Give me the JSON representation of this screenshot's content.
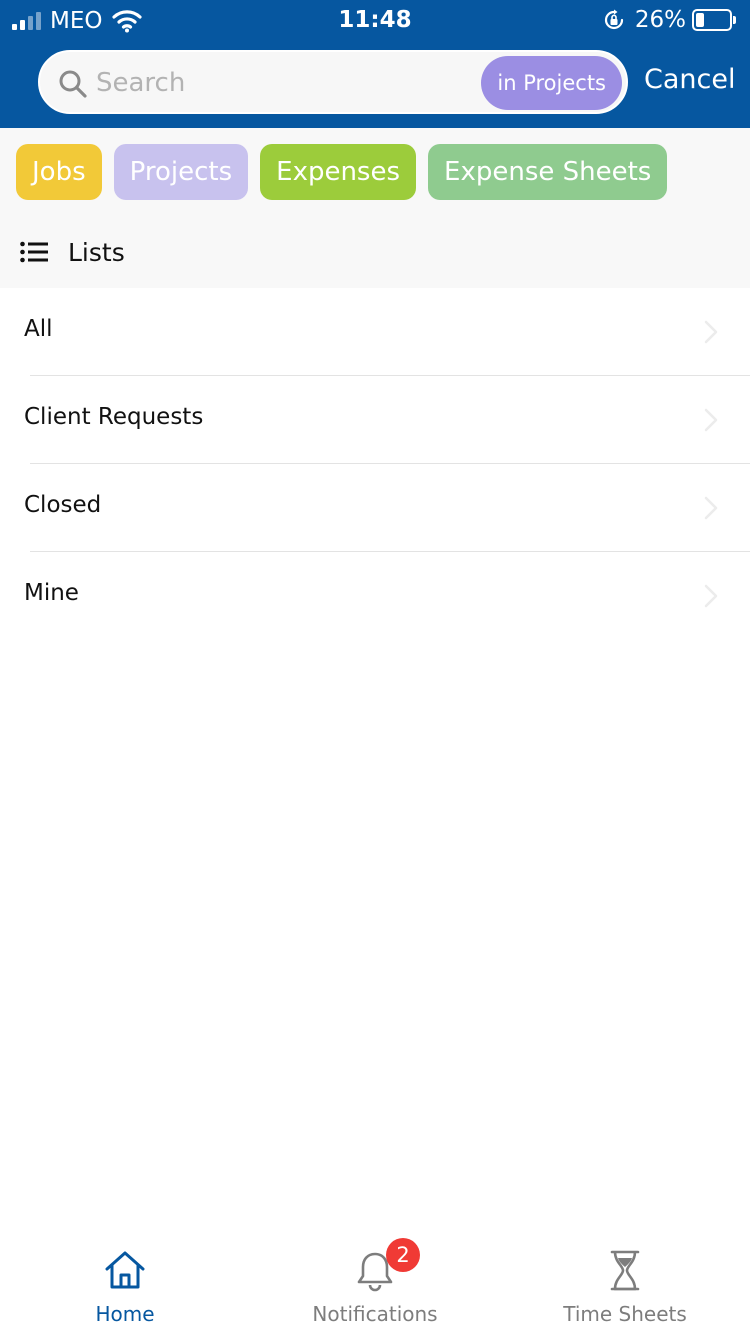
{
  "status_bar": {
    "carrier": "MEO",
    "time": "11:48",
    "battery_percent": "26%",
    "battery_level": 0.26
  },
  "search": {
    "placeholder": "Search",
    "value": "",
    "scope_label": "in Projects",
    "cancel_label": "Cancel"
  },
  "filters": [
    {
      "label": "Jobs",
      "color": "#f2c938"
    },
    {
      "label": "Projects",
      "color": "#c8c2ee"
    },
    {
      "label": "Expenses",
      "color": "#9ccc3b"
    },
    {
      "label": "Expense Sheets",
      "color": "#8fcb8f"
    }
  ],
  "lists": {
    "title": "Lists",
    "icon": "list-icon",
    "items": [
      {
        "label": "All"
      },
      {
        "label": "Client Requests"
      },
      {
        "label": "Closed"
      },
      {
        "label": "Mine"
      }
    ]
  },
  "tabbar": {
    "items": [
      {
        "label": "Home",
        "icon": "home-icon",
        "active": true
      },
      {
        "label": "Notifications",
        "icon": "bell-icon",
        "badge": "2"
      },
      {
        "label": "Time Sheets",
        "icon": "hourglass-icon"
      }
    ]
  },
  "colors": {
    "header": "#0657a0",
    "accent": "#0657a0",
    "scope_pill": "#9b8ee3",
    "badge": "#f03a35"
  }
}
